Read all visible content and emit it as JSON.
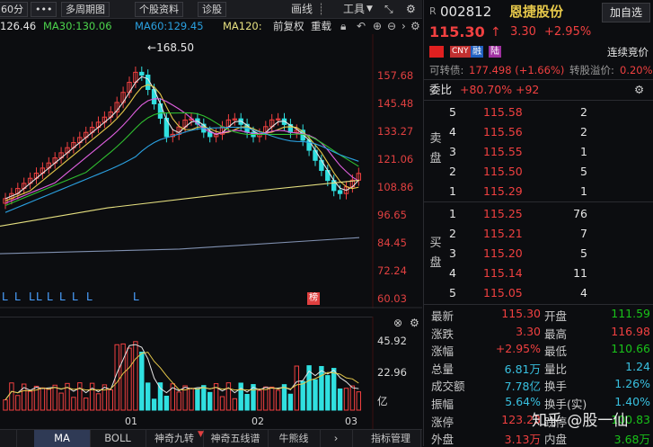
{
  "toolbar": {
    "period": "60分",
    "more": "•••",
    "multi_period": "多周期图",
    "stock_info": "个股资料",
    "diagnose": "诊股",
    "draw": "画线",
    "tools": "工具"
  },
  "ma_legend": {
    "ma_prefix": "126.46",
    "ma30": "MA30:130.06",
    "ma60": "MA60:129.45",
    "ma120": "MA120:",
    "fq": "前复权",
    "overlay": "重载"
  },
  "colors": {
    "ma5": "#e6e6e6",
    "ma10": "#e6c84a",
    "ma20": "#e060e0",
    "ma30": "#30c030",
    "ma60": "#2aa0e0",
    "ma120": "#e6e080",
    "ma250": "#8090b0",
    "up": "#f04040",
    "down": "#30e0e0"
  },
  "main_chart": {
    "max_label": "168.50",
    "y_labels": [
      "157.68",
      "145.48",
      "133.27",
      "121.06",
      "108.86",
      "96.65",
      "84.45",
      "72.24",
      "60.03"
    ],
    "l_markers": [
      "L",
      "L",
      "L",
      "L",
      "L",
      "L",
      "L",
      "L",
      "L"
    ],
    "pledge_badge": "榜"
  },
  "volume_chart": {
    "y_labels": [
      "45.92",
      "22.96",
      "亿"
    ],
    "x_labels": [
      "01",
      "02",
      "03"
    ]
  },
  "bottom_tabs": [
    "MA",
    "BOLL",
    "神奇九转",
    "神奇五线谱",
    "牛熊线",
    "指标管理"
  ],
  "quote": {
    "r_tag": "R",
    "code": "002812",
    "name": "恩捷股份",
    "add_button": "加自选",
    "price": "115.30",
    "arrow": "↑",
    "change": "3.30",
    "change_pct": "+2.95%",
    "badges": [
      "CNY",
      "融",
      "陆"
    ],
    "auction": "连续竞价",
    "convertible_label": "可转债:",
    "convertible_value": "177.498 (+1.66%)",
    "premium_label": "转股溢价:",
    "premium_value": "0.20%",
    "commit_ratio_label": "委比",
    "commit_ratio_value": "+80.70%",
    "commit_diff": "+92"
  },
  "order_book": {
    "sell_label": [
      "卖",
      "盘"
    ],
    "buy_label": [
      "买",
      "盘"
    ],
    "sells": [
      {
        "idx": "5",
        "price": "115.58",
        "vol": "2"
      },
      {
        "idx": "4",
        "price": "115.56",
        "vol": "2"
      },
      {
        "idx": "3",
        "price": "115.55",
        "vol": "1"
      },
      {
        "idx": "2",
        "price": "115.50",
        "vol": "5"
      },
      {
        "idx": "1",
        "price": "115.29",
        "vol": "1"
      }
    ],
    "buys": [
      {
        "idx": "1",
        "price": "115.25",
        "vol": "76"
      },
      {
        "idx": "2",
        "price": "115.21",
        "vol": "7"
      },
      {
        "idx": "3",
        "price": "115.20",
        "vol": "5"
      },
      {
        "idx": "4",
        "price": "115.14",
        "vol": "11"
      },
      {
        "idx": "5",
        "price": "115.05",
        "vol": "4"
      }
    ]
  },
  "stats": {
    "rows": [
      {
        "l1": "最新",
        "v1": "115.30",
        "c1": "red",
        "l2": "开盘",
        "v2": "111.59",
        "c2": "green"
      },
      {
        "l1": "涨跌",
        "v1": "3.30",
        "c1": "red",
        "l2": "最高",
        "v2": "116.98",
        "c2": "red"
      },
      {
        "l1": "涨幅",
        "v1": "+2.95%",
        "c1": "red",
        "l2": "最低",
        "v2": "110.66",
        "c2": "green"
      },
      {
        "l1": "总量",
        "v1": "6.81万",
        "c1": "cyan",
        "l2": "量比",
        "v2": "1.24",
        "c2": "cyan"
      },
      {
        "l1": "成交额",
        "v1": "7.78亿",
        "c1": "cyan",
        "l2": "换手",
        "v2": "1.26%",
        "c2": "cyan"
      },
      {
        "l1": "振幅",
        "v1": "5.64%",
        "c1": "cyan",
        "l2": "换手(实)",
        "v2": "1.40%",
        "c2": "cyan"
      },
      {
        "l1": "涨停",
        "v1": "123.23",
        "c1": "red",
        "l2": "跌停",
        "v2": "100.83",
        "c2": "green"
      },
      {
        "l1": "外盘",
        "v1": "3.13万",
        "c1": "red",
        "l2": "内盘",
        "v2": "3.68万",
        "c2": "green"
      }
    ]
  },
  "watermark": "知乎 @股一仙"
}
